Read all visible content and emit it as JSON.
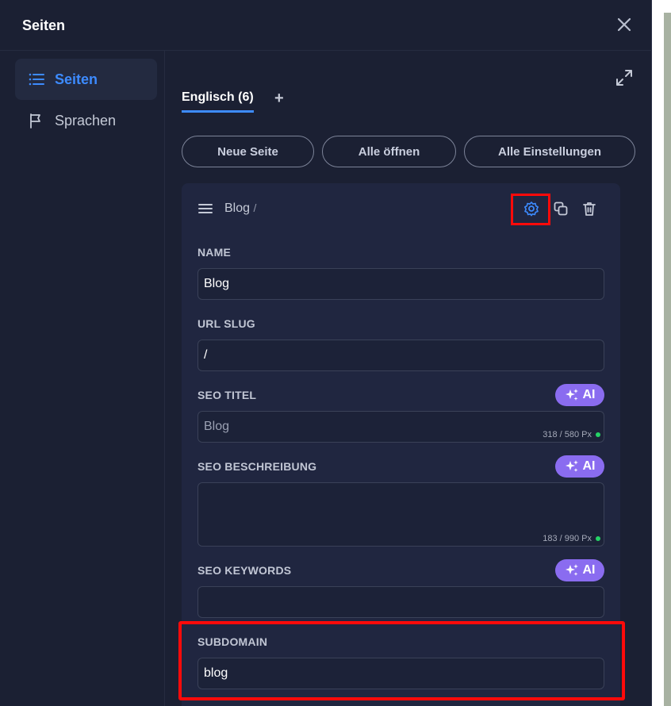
{
  "header": {
    "title": "Seiten"
  },
  "sidebar": {
    "items": [
      {
        "label": "Seiten",
        "icon": "list-icon",
        "active": true
      },
      {
        "label": "Sprachen",
        "icon": "flag-icon",
        "active": false
      }
    ]
  },
  "tabs": [
    {
      "label": "Englisch (6)"
    }
  ],
  "tab_add": "+",
  "toolbar": {
    "new_page": "Neue Seite",
    "open_all": "Alle öffnen",
    "all_settings": "Alle Einstellungen"
  },
  "page_card": {
    "breadcrumb": "Blog",
    "breadcrumb_suffix": "/",
    "fields": {
      "name": {
        "label": "NAME",
        "value": "Blog"
      },
      "url_slug": {
        "label": "URL SLUG",
        "value": "/"
      },
      "seo_title": {
        "label": "SEO TITEL",
        "value": "Blog",
        "counter": "318 / 580 Px"
      },
      "seo_description": {
        "label": "SEO BESCHREIBUNG",
        "value": "",
        "counter": "183 / 990 Px"
      },
      "seo_keywords": {
        "label": "SEO KEYWORDS",
        "value": ""
      },
      "subdomain": {
        "label": "SUBDOMAIN",
        "value": "blog"
      }
    },
    "ai_label": "AI"
  },
  "colors": {
    "accent": "#3d8bff",
    "ai_button": "#8a6cf0",
    "highlight": "#ff0a0a",
    "status_ok": "#25d366"
  }
}
